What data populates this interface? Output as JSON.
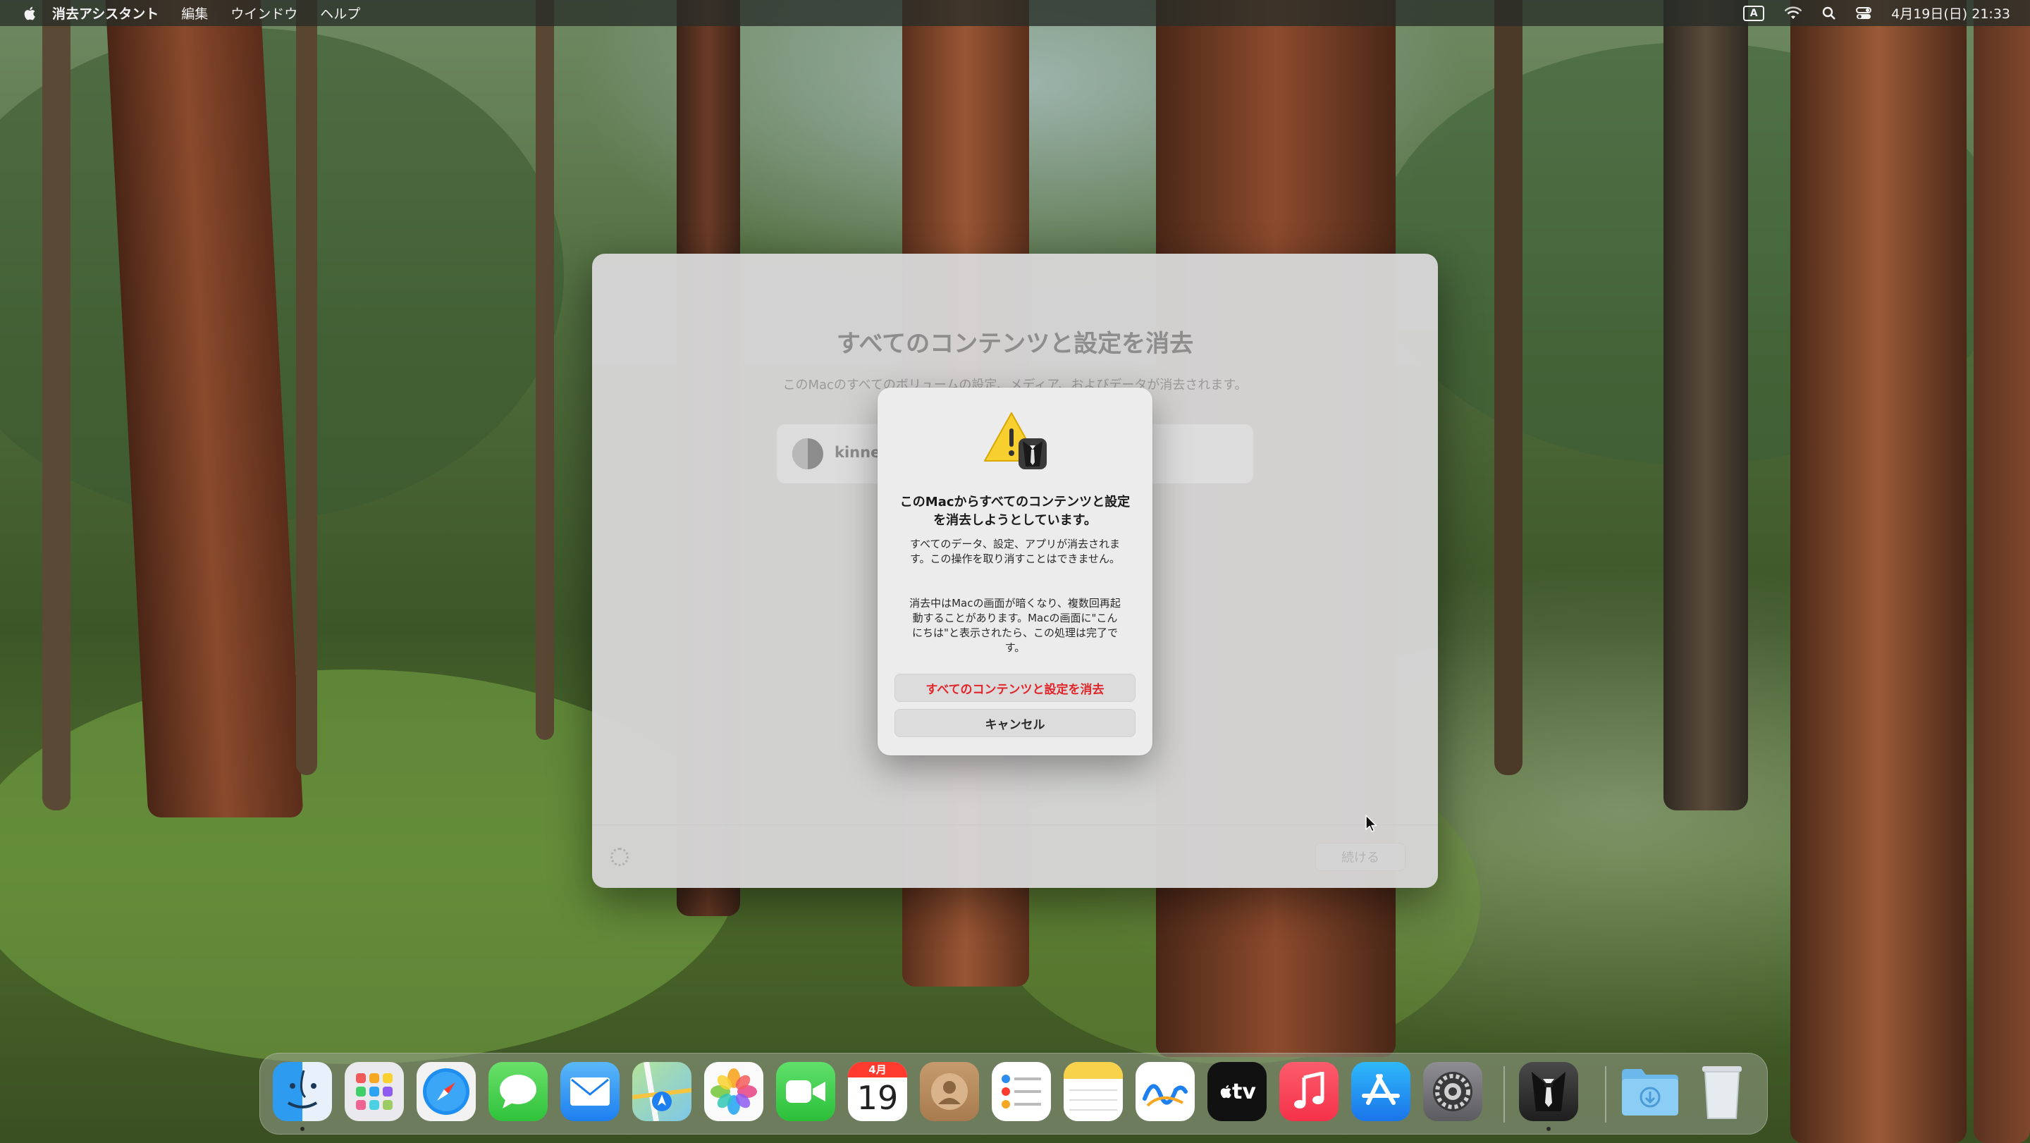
{
  "menubar": {
    "app_name": "消去アシスタント",
    "items": [
      "編集",
      "ウインドウ",
      "ヘルプ"
    ],
    "input_indicator": "A",
    "datetime": "4月19日(日) 21:33"
  },
  "window": {
    "title": "すべてのコンテンツと設定を消去",
    "subtitle": "このMacのすべてのボリュームの設定、メディア、およびデータが消去されます。",
    "account_name": "kinnek",
    "continue_label": "続ける"
  },
  "alert": {
    "title": "このMacからすべてのコンテンツと設定を消去しようとしています。",
    "body1": "すべてのデータ、設定、アプリが消去されます。この操作を取り消すことはできません。",
    "body2": "消去中はMacの画面が暗くなり、複数回再起動することがあります。Macの画面に\"こんにちは\"と表示されたら、この処理は完了です。",
    "erase_label": "すべてのコンテンツと設定を消去",
    "cancel_label": "キャンセル"
  },
  "dock": {
    "calendar_month": "4月",
    "calendar_day": "19",
    "tv_label": "tv",
    "items": [
      "finder",
      "launchpad",
      "safari",
      "messages",
      "mail",
      "maps",
      "photos",
      "facetime",
      "calendar",
      "contacts",
      "reminders",
      "notes",
      "freeform",
      "apple-tv",
      "music",
      "app-store",
      "system-settings",
      "erase-assistant",
      "downloads",
      "trash"
    ]
  },
  "colors": {
    "destructive": "#e0262a",
    "alert_bg": "#ececec",
    "window_bg": "#d6d6d6"
  }
}
